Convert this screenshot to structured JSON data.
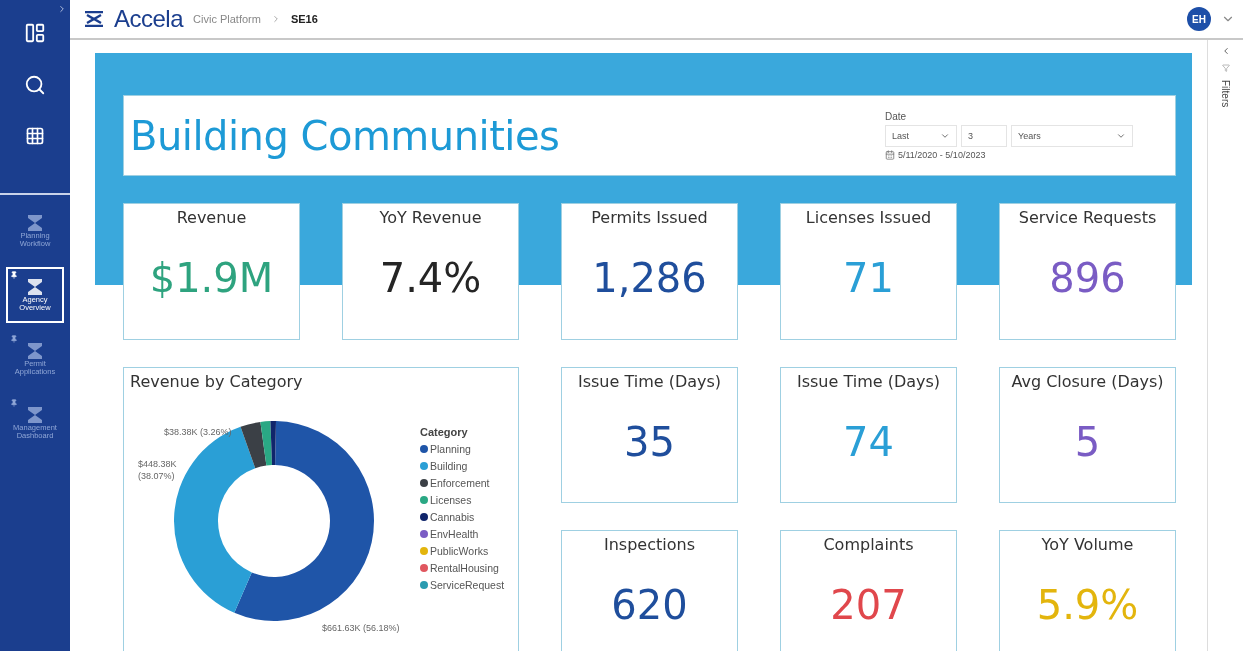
{
  "header": {
    "brand": "Accela",
    "breadcrumb": [
      {
        "label": "Civic Platform",
        "current": false
      },
      {
        "label": "SE16",
        "current": true
      }
    ],
    "avatar": "EH"
  },
  "sidebar": {
    "items": [
      {
        "label": "Planning Workflow",
        "selected": false,
        "pinned": false
      },
      {
        "label": "Agency Overview",
        "selected": true,
        "pinned": true
      },
      {
        "label": "Permit Applications",
        "selected": false,
        "pinned": true
      },
      {
        "label": "Management Dashboard",
        "selected": false,
        "pinned": true
      }
    ]
  },
  "filters_pane": {
    "label": "Filters"
  },
  "report": {
    "title": "Building Communities",
    "date_slicer": {
      "label": "Date",
      "mode": "Last",
      "count": "3",
      "unit": "Years",
      "range": "5/11/2020 - 5/10/2023"
    },
    "kpis_top": [
      {
        "label": "Revenue",
        "value": "$1.9M",
        "color": "#2ea37f"
      },
      {
        "label": "YoY Revenue",
        "value": "7.4%",
        "color": "#252525"
      },
      {
        "label": "Permits Issued",
        "value": "1,286",
        "color": "#1f4e9c"
      },
      {
        "label": "Licenses Issued",
        "value": "71",
        "color": "#2a9fd6"
      },
      {
        "label": "Service Requests",
        "value": "896",
        "color": "#7a5cc4"
      }
    ],
    "kpis_bottom": [
      {
        "label": "Issue Time (Days)",
        "value": "35",
        "color": "#1f4e9c"
      },
      {
        "label": "Issue Time (Days)",
        "value": "74",
        "color": "#2a9fd6"
      },
      {
        "label": "Avg Closure (Days)",
        "value": "5",
        "color": "#7a5cc4"
      },
      {
        "label": "Inspections",
        "value": "620",
        "color": "#1f4e9c"
      },
      {
        "label": "Complaints",
        "value": "207",
        "color": "#e0474c"
      },
      {
        "label": "YoY Volume",
        "value": "5.9%",
        "color": "#e3b50d"
      }
    ],
    "revenue_chart": {
      "legend_title": "Category",
      "legend": [
        {
          "color": "#1f55a8"
        },
        {
          "color": "#2a9fd6"
        },
        {
          "color": "#3b4046"
        },
        {
          "color": "#2aa884"
        },
        {
          "color": "#10256b"
        },
        {
          "color": "#7a5cc4"
        },
        {
          "color": "#e3b50d"
        },
        {
          "color": "#e0575f"
        },
        {
          "color": "#2a9bb0"
        }
      ],
      "chart_data": {
        "type": "donut",
        "title": "Revenue by Category",
        "categories": [
          "Planning",
          "Building",
          "Enforcement",
          "Licenses",
          "Cannabis",
          "EnvHealth",
          "PublicWorks",
          "RentalHousing",
          "ServiceRequest"
        ],
        "values": [
          56.18,
          38.07,
          3.26,
          1.6,
          0.89,
          null,
          null,
          null,
          null
        ],
        "value_labels": [
          "$661.63K (56.18%)",
          "$448.38K (38.07%)",
          "$38.38K (3.26%)",
          null,
          null,
          null,
          null,
          null,
          null
        ]
      }
    }
  }
}
